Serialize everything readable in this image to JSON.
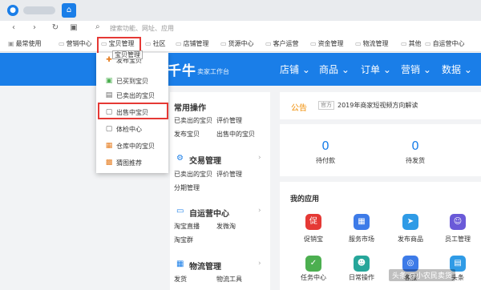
{
  "browser": {
    "search_icon": "search-icon",
    "address_placeholder": "搜索功能、网址、应用"
  },
  "bookmarks": [
    {
      "label": "最常使用"
    },
    {
      "label": "营销中心"
    },
    {
      "label": "宝贝管理"
    },
    {
      "label": "社区"
    },
    {
      "label": "店铺管理"
    },
    {
      "label": "货源中心"
    },
    {
      "label": "客户运营"
    },
    {
      "label": "资金管理"
    },
    {
      "label": "物流管理"
    },
    {
      "label": "其他"
    },
    {
      "label": "自运营中心"
    }
  ],
  "bookmark_tooltip": "宝贝管理",
  "header": {
    "brand": "千牛",
    "brand_sub": "卖家工作台",
    "nav": [
      {
        "label": "店铺"
      },
      {
        "label": "商品"
      },
      {
        "label": "订单"
      },
      {
        "label": "营销"
      },
      {
        "label": "数据"
      }
    ]
  },
  "dropdown": {
    "items": [
      {
        "label": "发布宝贝",
        "icon": "publish-icon",
        "color": "#e67e22"
      },
      {
        "label": "已买到宝贝",
        "icon": "bought-icon",
        "color": "#4caf50"
      },
      {
        "label": "已卖出的宝贝",
        "icon": "sold-icon",
        "color": "#666666"
      },
      {
        "label": "出售中宝贝",
        "icon": "selling-icon",
        "color": "#666666"
      },
      {
        "label": "体检中心",
        "icon": "checkup-icon",
        "color": "#666666"
      },
      {
        "label": "仓库中的宝贝",
        "icon": "warehouse-icon",
        "color": "#e67e22"
      },
      {
        "label": "猜图推荐",
        "icon": "recommend-icon",
        "color": "#e67e22"
      }
    ]
  },
  "common_ops": {
    "title": "常用操作",
    "links": [
      "已卖出的宝贝",
      "评价管理",
      "发布宝贝",
      "出售中的宝贝"
    ]
  },
  "trade": {
    "title": "交易管理",
    "links": [
      "已卖出的宝贝",
      "评价管理",
      "分期管理"
    ]
  },
  "self_ops": {
    "title": "自运营中心",
    "links": [
      "淘宝直播",
      "发微淘",
      "淘宝群"
    ]
  },
  "logistics": {
    "title": "物流管理",
    "links": [
      "发货",
      "物流工具"
    ]
  },
  "notice": {
    "title": "公告",
    "badge": "官方",
    "text": "2019年商家短视频方向解读"
  },
  "stats": [
    {
      "value": "0",
      "label": "待付款"
    },
    {
      "value": "0",
      "label": "待发货"
    }
  ],
  "apps": {
    "title": "我的应用",
    "items": [
      {
        "label": "促销宝",
        "icon": "promo-icon",
        "color": "#e53935",
        "glyph": "促"
      },
      {
        "label": "服务市场",
        "icon": "market-icon",
        "color": "#3d7be8",
        "glyph": "▦"
      },
      {
        "label": "发布商品",
        "icon": "send-icon",
        "color": "#2f9be6",
        "glyph": "➤"
      },
      {
        "label": "员工管理",
        "icon": "staff-icon",
        "color": "#6a5ad8",
        "glyph": "☺"
      },
      {
        "label": "任务中心",
        "icon": "task-icon",
        "color": "#4caf50",
        "glyph": "✓"
      },
      {
        "label": "日常操作",
        "icon": "daily-icon",
        "color": "#26a69a",
        "glyph": "☻"
      },
      {
        "label": "客服",
        "icon": "service-icon",
        "color": "#3d7be8",
        "glyph": "◎"
      },
      {
        "label": "头条",
        "icon": "news-icon",
        "color": "#2f9be6",
        "glyph": "▤"
      }
    ]
  },
  "watermark": "头条 @小农民卖货",
  "colors": {
    "brand_blue": "#1a7ee8",
    "highlight_red": "#e53935",
    "notice_orange": "#f08c00"
  }
}
